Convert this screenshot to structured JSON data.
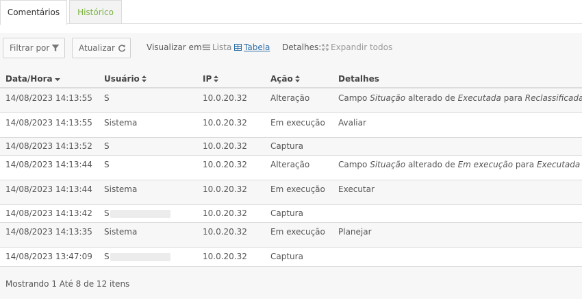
{
  "tabs": [
    {
      "label": "Comentários"
    },
    {
      "label": "Histórico"
    }
  ],
  "toolbar": {
    "filter_label": "Filtrar por",
    "refresh_label": "Atualizar",
    "view_label": "Visualizar em:",
    "view_list": "Lista",
    "view_table": "Tabela",
    "details_label": "Detalhes:",
    "expand_all": "Expandir todos"
  },
  "table": {
    "columns": [
      "Data/Hora",
      "Usuário",
      "IP",
      "Ação",
      "Detalhes"
    ],
    "rows": [
      {
        "date": "14/08/2023 14:13:55",
        "user": "S",
        "ip": "10.0.20.32",
        "action": "Alteração",
        "details": {
          "p1": "Campo ",
          "f": "Situação",
          "p2": " alterado de ",
          "from": "Executada",
          "p3": " para ",
          "to": "Reclassificada"
        }
      },
      {
        "date": "14/08/2023 14:13:55",
        "user": "Sistema",
        "ip": "10.0.20.32",
        "action": "Em execução",
        "details_text": "Avaliar"
      },
      {
        "date": "14/08/2023 14:13:52",
        "user": "S",
        "ip": "10.0.20.32",
        "action": "Captura",
        "details_text": ""
      },
      {
        "date": "14/08/2023 14:13:44",
        "user": "S",
        "ip": "10.0.20.32",
        "action": "Alteração",
        "details": {
          "p1": "Campo ",
          "f": "Situação",
          "p2": " alterado de ",
          "from": "Em execução",
          "p3": " para ",
          "to": "Executada"
        }
      },
      {
        "date": "14/08/2023 14:13:44",
        "user": "Sistema",
        "ip": "10.0.20.32",
        "action": "Em execução",
        "details_text": "Executar"
      },
      {
        "date": "14/08/2023 14:13:42",
        "user": "S",
        "ip": "10.0.20.32",
        "action": "Captura",
        "details_text": ""
      },
      {
        "date": "14/08/2023 14:13:35",
        "user": "Sistema",
        "ip": "10.0.20.32",
        "action": "Em execução",
        "details_text": "Planejar"
      },
      {
        "date": "14/08/2023 13:47:09",
        "user": "S",
        "ip": "10.0.20.32",
        "action": "Captura",
        "details_text": ""
      }
    ]
  },
  "footer": {
    "text": "Mostrando 1 Até 8 de 12 itens"
  },
  "colors": {
    "accent_green": "#7cb342",
    "link_blue": "#2f6fa8"
  }
}
